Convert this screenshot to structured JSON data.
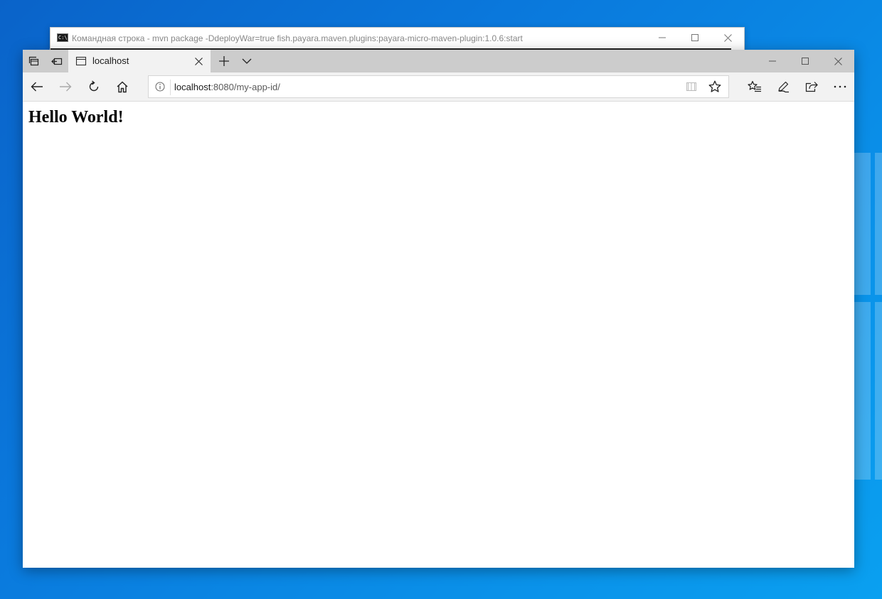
{
  "console_window": {
    "title": "Командная строка - mvn  package -DdeployWar=true fish.payara.maven.plugins:payara-micro-maven-plugin:1.0.6:start",
    "icon_text": "C:\\"
  },
  "browser": {
    "tab": {
      "label": "localhost",
      "icon": "page-icon"
    },
    "address": {
      "host": "localhost",
      "rest": ":8080/my-app-id/"
    },
    "icons": {
      "set_aside": "tabs-aside-icon",
      "restore": "tabs-restore-icon",
      "new_tab": "plus-icon",
      "tab_preview": "chevron-down-icon",
      "back": "arrow-left-icon",
      "forward": "arrow-right-icon",
      "refresh": "refresh-icon",
      "home": "home-icon",
      "info": "info-icon",
      "reading_view": "book-icon",
      "favorite": "star-icon",
      "favorites_hub": "favorites-list-icon",
      "notes": "pen-icon",
      "share": "share-icon",
      "more": "more-icon"
    }
  },
  "page": {
    "heading": "Hello World!"
  },
  "colors": {
    "desktop": "#0a78dc",
    "tabbar": "#cccccc",
    "toolbar": "#f2f2f2"
  }
}
